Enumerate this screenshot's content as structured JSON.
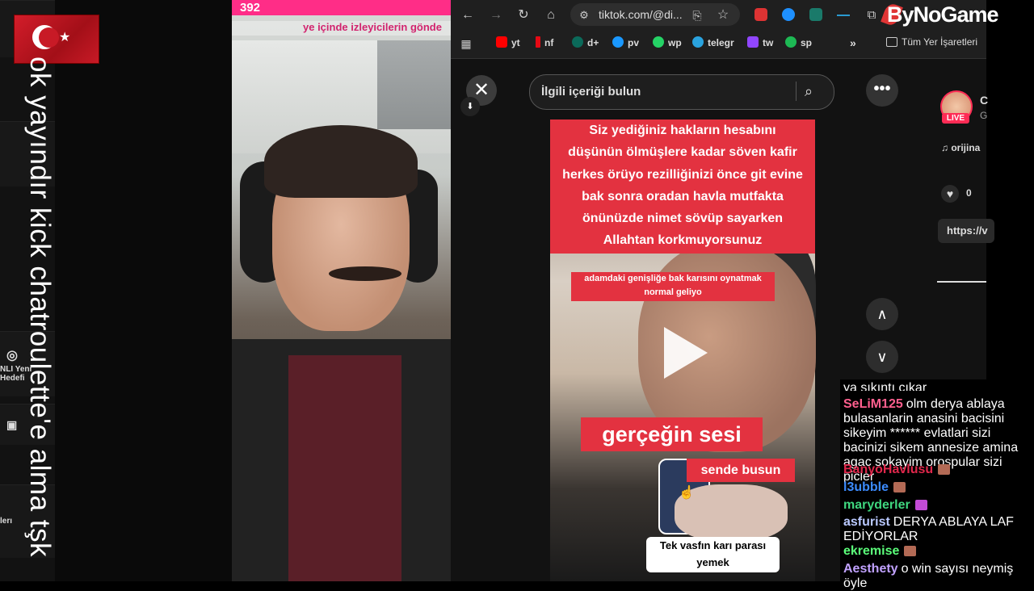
{
  "overlay": {
    "viewer_count": "392",
    "ticker_text": "ye içinde izleyicilerin gönde",
    "vertical_banner": "ok yayındır kick chatroulette'e alma tşk",
    "sidebar": [
      {
        "label": "NLI Yeni Hedefi"
      },
      {
        "label": "lerı"
      }
    ],
    "brand": "ByNoGame"
  },
  "browser": {
    "url": "tiktok.com/@di...",
    "bookmarks": [
      {
        "label": "yt",
        "color": "#ff0000"
      },
      {
        "label": "nf",
        "color": "#e50914"
      },
      {
        "label": "d+",
        "color": "#0b6a5a"
      },
      {
        "label": "pv",
        "color": "#1a98ff"
      },
      {
        "label": "wp",
        "color": "#25d366"
      },
      {
        "label": "telegr",
        "color": "#2aa3df"
      },
      {
        "label": "tw",
        "color": "#9146ff"
      },
      {
        "label": "sp",
        "color": "#1db954"
      }
    ],
    "all_bookmarks": "Tüm Yer İşaretleri"
  },
  "tiktok": {
    "search_placeholder": "İlgili içeriği bulun",
    "caption_lines": [
      "Siz yediğiniz hakların hesabını",
      "düşünün ölmüşlere kadar söven kafir",
      "herkes örüyo rezilliğinizi önce git evine",
      "bak sonra oradan havla mutfakta",
      "önünüzde nimet sövüp sayarken",
      "Allahtan korkmuyorsunuz"
    ],
    "sub_caption_lines": [
      "adamdaki genişliğe bak karısını oynatmak",
      "normal geliyo"
    ],
    "caption_big": "gerçeğin sesi",
    "caption_small": "sende busun",
    "caption_bottom_lines": [
      "Tek vasfın karı parası",
      "yemek"
    ],
    "live_badge": "LIVE",
    "music": "♫ orijina",
    "like_count": "0",
    "link": "https://v",
    "author_initial": "C",
    "author_sub": "G"
  },
  "chat": [
    {
      "user": "",
      "text": "ya sıkıntı çıkar",
      "color": "#ffffff",
      "emote": false
    },
    {
      "user": "SeLiM125",
      "text": "olm derya ablaya bulasanlarin anasini bacisini sikeyim ****** evlatlari sizi bacinizi sikem annesize amina agac sokayim orospular sizi picler",
      "color": "#ff5f8e",
      "emote": false
    },
    {
      "user": "BanyoHavlusu",
      "text": "",
      "color": "#e0274b",
      "emote": true
    },
    {
      "user": "l3ubble",
      "text": "",
      "color": "#3c8cff",
      "emote": true
    },
    {
      "user": "maryderler",
      "text": "",
      "color": "#3fd77f",
      "emote": true
    },
    {
      "user": "asfurist",
      "text": "DERYA ABLAYA LAF EDİYORLAR",
      "color": "#b9c8ff",
      "emote": false
    },
    {
      "user": "ekremise",
      "text": "",
      "color": "#5bff7a",
      "emote": true
    },
    {
      "user": "Aesthety",
      "text": "o win sayısı neymiş öyle",
      "color": "#c1a2ff",
      "emote": false
    }
  ]
}
